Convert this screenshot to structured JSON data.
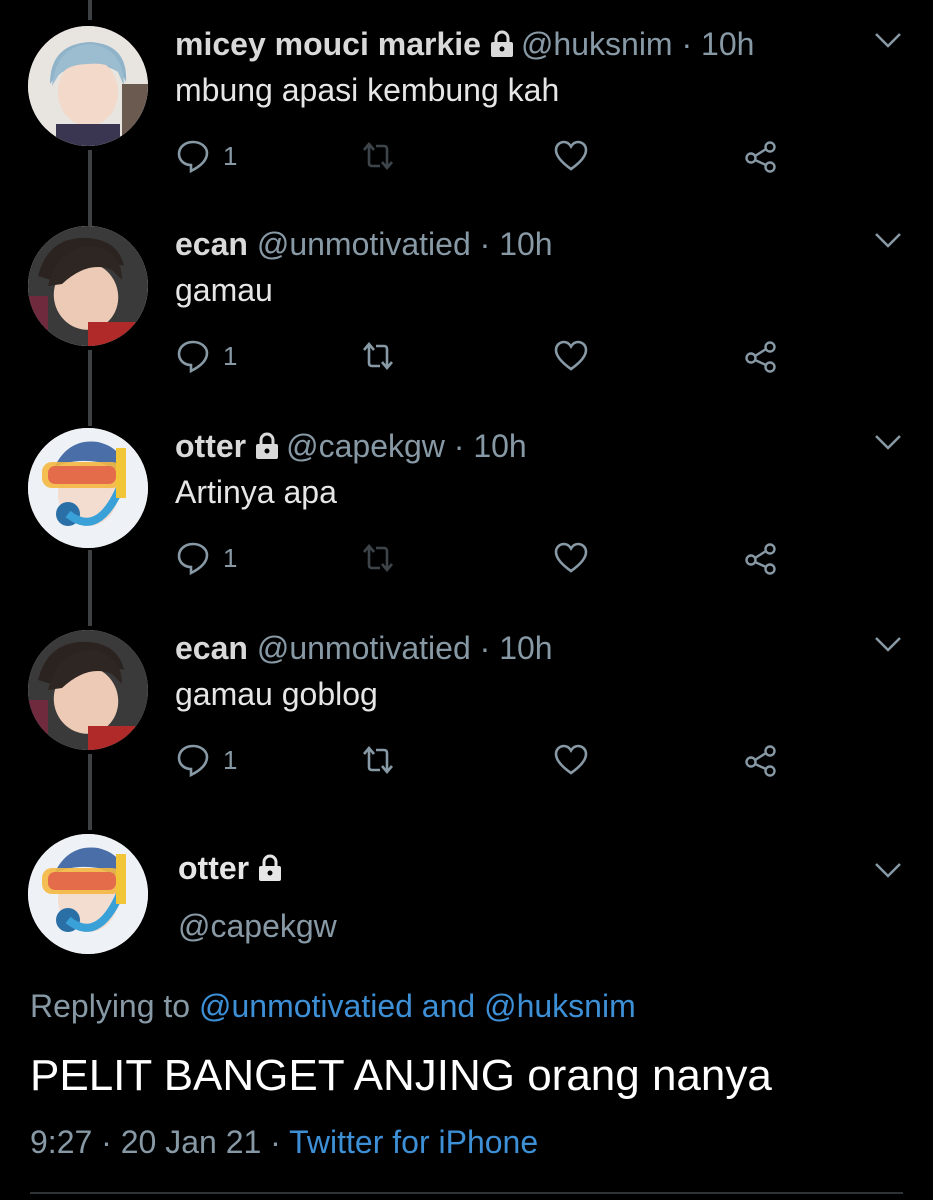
{
  "tweets": [
    {
      "name": "micey mouci markie",
      "locked": true,
      "handle": "@huksnim",
      "dot": "·",
      "time": "10h",
      "text": "mbung apasi kembung kah",
      "reply_count": "1",
      "retweet_enabled": false
    },
    {
      "name": "ecan",
      "locked": false,
      "handle": "@unmotivatied",
      "dot": "·",
      "time": "10h",
      "text": "gamau",
      "reply_count": "1",
      "retweet_enabled": true
    },
    {
      "name": "otter",
      "locked": true,
      "handle": "@capekgw",
      "dot": "·",
      "time": "10h",
      "text": "Artinya apa",
      "reply_count": "1",
      "retweet_enabled": false
    },
    {
      "name": "ecan",
      "locked": false,
      "handle": "@unmotivatied",
      "dot": "·",
      "time": "10h",
      "text": "gamau goblog",
      "reply_count": "1",
      "retweet_enabled": true
    }
  ],
  "main_tweet": {
    "name": "otter",
    "handle": "@capekgw",
    "replying_prefix": "Replying to",
    "mention_1": "@unmotivatied",
    "mention_join": "and",
    "mention_2": "@huksnim",
    "text": "PELIT BANGET ANJING orang nanya",
    "time": "9:27",
    "dot": "·",
    "date": "20 Jan 21",
    "source": "Twitter for iPhone"
  },
  "colors": {
    "background": "#000000",
    "secondary_text": "#8899a6",
    "link": "#3d8fd6",
    "primary_text": "#e6e6e6"
  }
}
